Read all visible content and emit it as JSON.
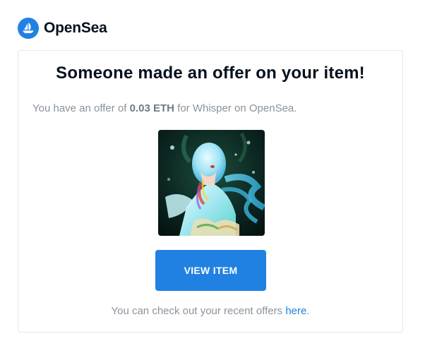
{
  "brand": {
    "name": "OpenSea",
    "logo_icon": "opensea-ship-icon",
    "accent_color": "#2081e2"
  },
  "email": {
    "headline": "Someone made an offer on your item!",
    "message": {
      "prefix": "You have an offer of ",
      "amount": "0.03 ETH",
      "suffix": " for Whisper on OpenSea."
    },
    "item_image": {
      "icon": "nft-artwork-image"
    },
    "button_label": "VIEW ITEM",
    "footer": {
      "text": "You can check out your recent offers ",
      "link_label": "here",
      "end": "."
    }
  }
}
